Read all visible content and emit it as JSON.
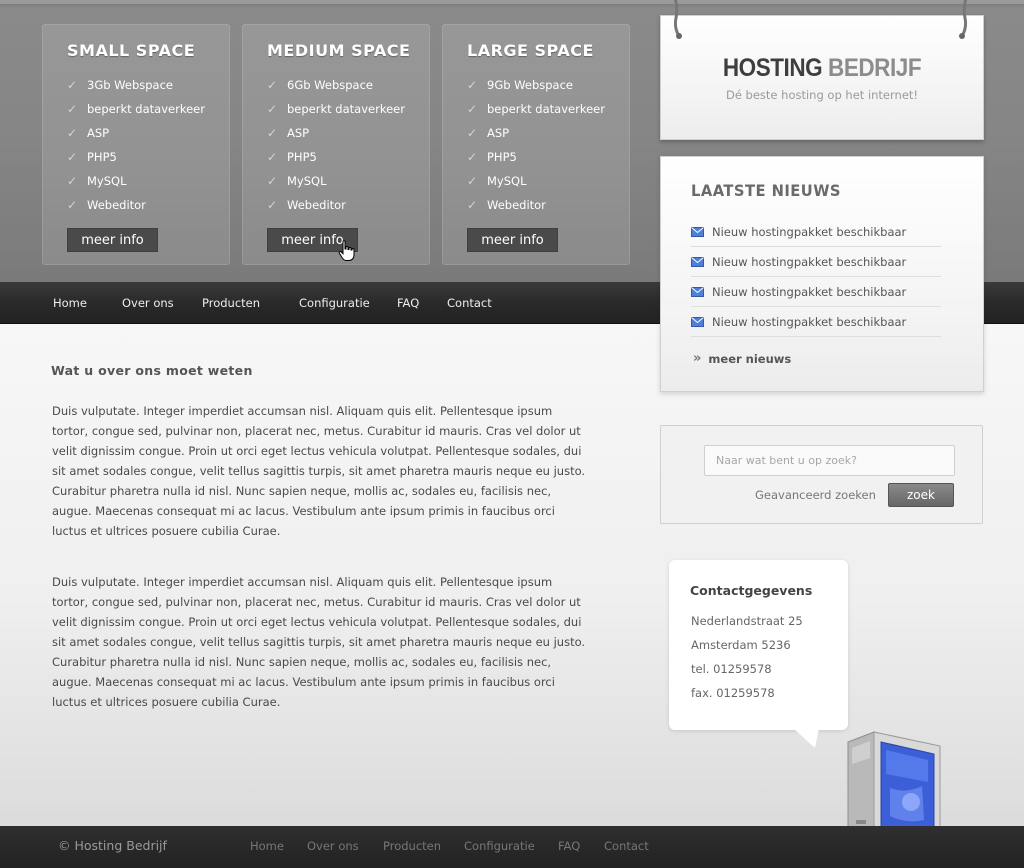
{
  "packages": [
    {
      "title": "SMALL SPACE",
      "features": [
        "3Gb Webspace",
        "beperkt dataverkeer",
        "ASP",
        "PHP5",
        "MySQL",
        "Webeditor"
      ],
      "button_label": "meer info"
    },
    {
      "title": "MEDIUM SPACE",
      "features": [
        "6Gb Webspace",
        "beperkt dataverkeer",
        "ASP",
        "PHP5",
        "MySQL",
        "Webeditor"
      ],
      "button_label": "meer info"
    },
    {
      "title": "LARGE SPACE",
      "features": [
        "9Gb Webspace",
        "beperkt dataverkeer",
        "ASP",
        "PHP5",
        "MySQL",
        "Webeditor"
      ],
      "button_label": "meer info"
    }
  ],
  "logo": {
    "word_dark": "HOSTING",
    "word_light": "BEDRIJF",
    "tagline": "Dé beste hosting op het internet!"
  },
  "nav": {
    "items": [
      "Home",
      "Over ons",
      "Producten",
      "Configuratie",
      "FAQ",
      "Contact"
    ]
  },
  "news": {
    "title": "LAATSTE NIEUWS",
    "items": [
      "Nieuw hostingpakket beschikbaar",
      "Nieuw hostingpakket beschikbaar",
      "Nieuw hostingpakket beschikbaar",
      "Nieuw hostingpakket beschikbaar"
    ],
    "more_label": "meer nieuws"
  },
  "search": {
    "placeholder": "Naar wat bent u op zoek?",
    "advanced_label": "Geavanceerd zoeken",
    "button_label": "zoek"
  },
  "contact": {
    "title": "Contactgegevens",
    "lines": [
      "Nederlandstraat 25",
      "Amsterdam 5236",
      "tel. 01259578",
      "fax. 01259578"
    ]
  },
  "content": {
    "title": "Wat u over ons moet weten",
    "paragraphs": [
      "Duis vulputate. Integer imperdiet accumsan nisl. Aliquam quis elit. Pellentesque ipsum tortor, congue sed, pulvinar non, placerat nec, metus. Curabitur id mauris. Cras vel dolor ut velit dignissim congue. Proin ut orci eget lectus vehicula volutpat. Pellentesque sodales, dui sit amet sodales congue, velit tellus sagittis turpis, sit amet pharetra mauris neque eu justo. Curabitur pharetra nulla id nisl. Nunc sapien neque, mollis ac, sodales eu, facilisis nec, augue. Maecenas consequat mi ac lacus. Vestibulum ante ipsum primis in faucibus orci luctus et ultrices posuere cubilia Curae.",
      "Duis vulputate. Integer imperdiet accumsan nisl. Aliquam quis elit. Pellentesque ipsum tortor, congue sed, pulvinar non, placerat nec, metus. Curabitur id mauris. Cras vel dolor ut velit dignissim congue. Proin ut orci eget lectus vehicula volutpat. Pellentesque sodales, dui sit amet sodales congue, velit tellus sagittis turpis, sit amet pharetra mauris neque eu justo. Curabitur pharetra nulla id nisl. Nunc sapien neque, mollis ac, sodales eu, facilisis nec, augue. Maecenas consequat mi ac lacus. Vestibulum ante ipsum primis in faucibus orci luctus et ultrices posuere cubilia Curae."
    ]
  },
  "footer": {
    "copyright": "© Hosting Bedrijf",
    "links": [
      "Home",
      "Over ons",
      "Producten",
      "Configuratie",
      "FAQ",
      "Contact"
    ]
  },
  "icons": {
    "check": "check-icon",
    "news": "envelope-icon",
    "more": "double-chevron-icon",
    "cursor": "hand-cursor-icon",
    "server": "server-tower-icon"
  },
  "colors": {
    "header_gray": "#858585",
    "nav_dark": "#2a2a2a",
    "footer_dark": "#262626",
    "button_dark": "#4a4a4a",
    "accent_blue": "#3c5fd8"
  }
}
